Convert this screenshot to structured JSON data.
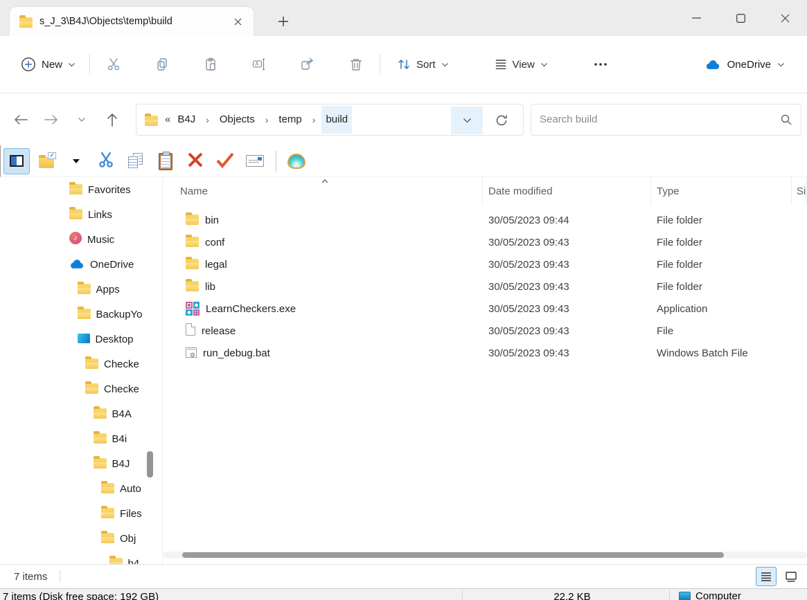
{
  "window": {
    "tab_title": "s_J_3\\B4J\\Objects\\temp\\build"
  },
  "command_bar": {
    "new_label": "New",
    "sort_label": "Sort",
    "view_label": "View",
    "onedrive_label": "OneDrive",
    "accent_color": "#0e7fd9"
  },
  "address_bar": {
    "prefix": "«",
    "crumbs": [
      {
        "label": "B4J"
      },
      {
        "label": "Objects"
      },
      {
        "label": "temp"
      },
      {
        "label": "build",
        "_class": "active"
      }
    ],
    "search_placeholder": "Search build"
  },
  "classic_toolbar": {
    "buttons": [
      {
        "icon": "panel-toggle",
        "_class": "selected"
      },
      {
        "icon": "folder-new"
      },
      {
        "icon": "dropdown-arrow"
      },
      {
        "icon": "cut-blue"
      },
      {
        "icon": "copy-docs"
      },
      {
        "icon": "paste-board"
      },
      {
        "icon": "x-mark"
      },
      {
        "icon": "check-mark"
      },
      {
        "icon": "email"
      },
      {
        "icon": "divider",
        "_class": "is-divider",
        "_inter": "false"
      },
      {
        "icon": "shell"
      }
    ]
  },
  "sidebar": {
    "items": [
      {
        "label": "Favorites",
        "icon": "folder",
        "indent": 0
      },
      {
        "label": "Links",
        "icon": "folder",
        "indent": 0
      },
      {
        "label": "Music",
        "icon": "music",
        "indent": 0
      },
      {
        "label": "OneDrive",
        "icon": "onedrive",
        "indent": 0
      },
      {
        "label": "Apps",
        "icon": "folder",
        "indent": 1
      },
      {
        "label": "BackupYo",
        "icon": "folder",
        "indent": 1
      },
      {
        "label": "Desktop",
        "icon": "desktop",
        "indent": 1
      },
      {
        "label": "Checke",
        "icon": "folder",
        "indent": 2
      },
      {
        "label": "Checke",
        "icon": "folder",
        "indent": 2
      },
      {
        "label": "B4A",
        "icon": "folder",
        "indent": 3
      },
      {
        "label": "B4i",
        "icon": "folder",
        "indent": 3
      },
      {
        "label": "B4J",
        "icon": "folder",
        "indent": 3
      },
      {
        "label": "Auto",
        "icon": "folder",
        "indent": 4
      },
      {
        "label": "Files",
        "icon": "folder",
        "indent": 4
      },
      {
        "label": "Obj",
        "icon": "folder",
        "indent": 4
      },
      {
        "label": "b4",
        "icon": "folder",
        "indent": 5
      }
    ]
  },
  "file_list": {
    "columns": [
      "Name",
      "Date modified",
      "Type",
      "Si"
    ],
    "rows": [
      {
        "name": "bin",
        "icon": "folder",
        "date": "30/05/2023 09:44",
        "type": "File folder"
      },
      {
        "name": "conf",
        "icon": "folder",
        "date": "30/05/2023 09:43",
        "type": "File folder"
      },
      {
        "name": "legal",
        "icon": "folder",
        "date": "30/05/2023 09:43",
        "type": "File folder"
      },
      {
        "name": "lib",
        "icon": "folder",
        "date": "30/05/2023 09:43",
        "type": "File folder"
      },
      {
        "name": "LearnCheckers.exe",
        "icon": "checkers",
        "date": "30/05/2023 09:43",
        "type": "Application"
      },
      {
        "name": "release",
        "icon": "file",
        "date": "30/05/2023 09:43",
        "type": "File"
      },
      {
        "name": "run_debug.bat",
        "icon": "batch",
        "date": "30/05/2023 09:43",
        "type": "Windows Batch File"
      }
    ]
  },
  "status_bar": {
    "items_count": "7 items"
  },
  "background_window": {
    "status_left": "7 items (Disk free space: 192 GB)",
    "size_text": "22.2 KB",
    "computer_label": "Computer"
  }
}
